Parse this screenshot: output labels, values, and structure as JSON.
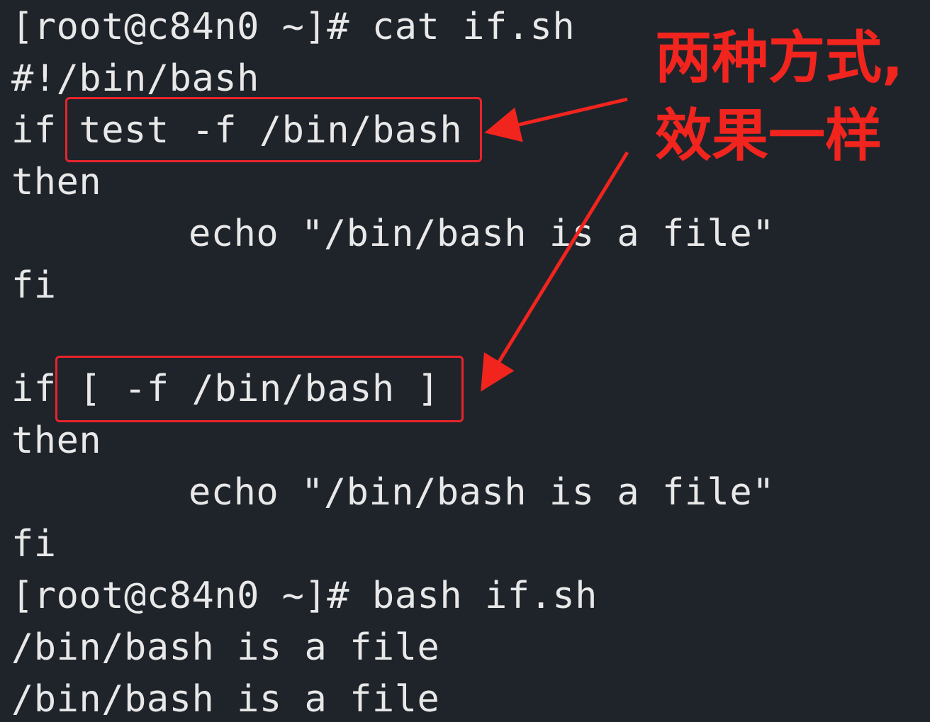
{
  "terminal": {
    "lines": [
      "[root@c84n0 ~]# cat if.sh",
      "#!/bin/bash",
      "if test -f /bin/bash",
      "then",
      "echo \"/bin/bash is a file\"",
      "fi",
      "",
      "if [ -f /bin/bash ]",
      "then",
      "echo \"/bin/bash is a file\"",
      "fi",
      "[root@c84n0 ~]# bash if.sh",
      "/bin/bash is a file",
      "/bin/bash is a file"
    ]
  },
  "annotation": {
    "line1": "两种方式,",
    "line2": "效果一样",
    "color": "#f2241e"
  },
  "colors": {
    "background": "#1f242b",
    "text": "#e8e8e8",
    "highlight": "#e8242b"
  }
}
